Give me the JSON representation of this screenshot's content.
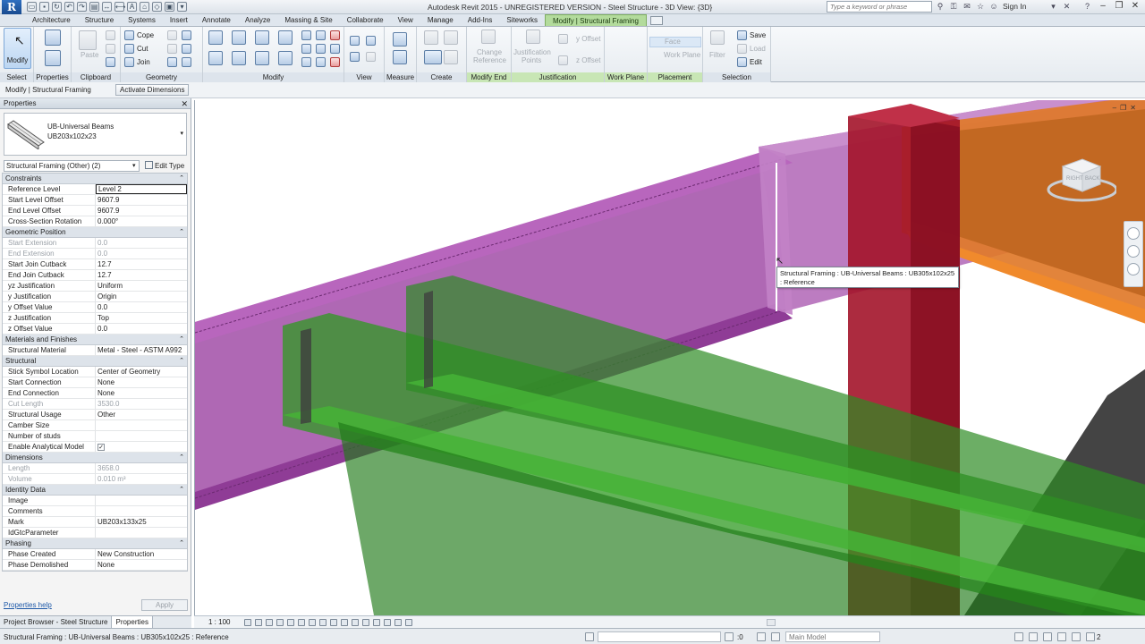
{
  "titlebar": {
    "app_button": "R",
    "window_title": "Autodesk Revit 2015 - UNREGISTERED VERSION -    Steel Structure - 3D View: {3D}",
    "search_placeholder": "Type a keyword or phrase",
    "sign_in": "Sign In"
  },
  "tabs": [
    "Architecture",
    "Structure",
    "Systems",
    "Insert",
    "Annotate",
    "Analyze",
    "Massing & Site",
    "Collaborate",
    "View",
    "Manage",
    "Add-Ins",
    "Siteworks",
    "Modify | Structural Framing"
  ],
  "ribbon": {
    "modify_label": "Modify",
    "panels": {
      "select": "Select",
      "properties": "Properties",
      "clipboard": "Clipboard",
      "geometry": "Geometry",
      "modify": "Modify",
      "view": "View",
      "measure": "Measure",
      "create": "Create",
      "modify_end": "Modify End",
      "justification": "Justification",
      "work_plane": "Work Plane",
      "placement": "Placement",
      "selection": "Selection"
    },
    "paste": "Paste",
    "cope": "Cope",
    "cut": "Cut",
    "join": "Join",
    "change_reference_1": "Change",
    "change_reference_2": "Reference",
    "justification_points_1": "Justification",
    "justification_points_2": "Points",
    "y_offset": "y Offset",
    "z_offset": "z Offset",
    "face": "Face",
    "work_plane_btn": "Work Plane",
    "filter": "Filter",
    "save": "Save",
    "load": "Load",
    "edit": "Edit"
  },
  "optbar": {
    "context": "Modify | Structural Framing",
    "activate_dimensions": "Activate Dimensions"
  },
  "properties": {
    "title": "Properties",
    "type_line1": "UB-Universal Beams",
    "type_line2": "UB203x102x23",
    "filter": "Structural Framing (Other) (2)",
    "edit_type": "Edit Type",
    "groups": [
      {
        "name": "Constraints",
        "rows": [
          {
            "k": "Reference Level",
            "v": "Level 2",
            "sel": true
          },
          {
            "k": "Start Level Offset",
            "v": "9607.9"
          },
          {
            "k": "End Level Offset",
            "v": "9607.9"
          },
          {
            "k": "Cross-Section Rotation",
            "v": "0.000°"
          }
        ]
      },
      {
        "name": "Geometric Position",
        "rows": [
          {
            "k": "Start Extension",
            "v": "0.0",
            "dim": true
          },
          {
            "k": "End Extension",
            "v": "0.0",
            "dim": true
          },
          {
            "k": "Start Join Cutback",
            "v": "12.7"
          },
          {
            "k": "End Join Cutback",
            "v": "12.7"
          },
          {
            "k": "yz Justification",
            "v": "Uniform"
          },
          {
            "k": "y Justification",
            "v": "Origin"
          },
          {
            "k": "y Offset Value",
            "v": "0.0"
          },
          {
            "k": "z Justification",
            "v": "Top"
          },
          {
            "k": "z Offset Value",
            "v": "0.0"
          }
        ]
      },
      {
        "name": "Materials and Finishes",
        "rows": [
          {
            "k": "Structural Material",
            "v": "Metal - Steel - ASTM A992"
          }
        ]
      },
      {
        "name": "Structural",
        "rows": [
          {
            "k": "Stick Symbol Location",
            "v": "Center of Geometry"
          },
          {
            "k": "Start Connection",
            "v": "None"
          },
          {
            "k": "End Connection",
            "v": "None"
          },
          {
            "k": "Cut Length",
            "v": "3530.0",
            "dim": true
          },
          {
            "k": "Structural Usage",
            "v": "Other"
          },
          {
            "k": "Camber Size",
            "v": ""
          },
          {
            "k": "Number of studs",
            "v": ""
          },
          {
            "k": "Enable Analytical Model",
            "v": "✓",
            "check": true
          }
        ]
      },
      {
        "name": "Dimensions",
        "rows": [
          {
            "k": "Length",
            "v": "3658.0",
            "dim": true
          },
          {
            "k": "Volume",
            "v": "0.010 m³",
            "dim": true
          }
        ]
      },
      {
        "name": "Identity Data",
        "rows": [
          {
            "k": "Image",
            "v": ""
          },
          {
            "k": "Comments",
            "v": ""
          },
          {
            "k": "Mark",
            "v": "UB203x133x25"
          },
          {
            "k": "IdGtcParameter",
            "v": ""
          }
        ]
      },
      {
        "name": "Phasing",
        "rows": [
          {
            "k": "Phase Created",
            "v": "New Construction"
          },
          {
            "k": "Phase Demolished",
            "v": "None"
          }
        ]
      }
    ],
    "help": "Properties help",
    "apply": "Apply"
  },
  "browser_tabs": [
    "Project Browser - Steel Structure",
    "Properties"
  ],
  "view": {
    "tooltip_line1": "Structural Framing : UB-Universal Beams : UB305x102x25",
    "tooltip_line2": ": Reference",
    "viewcube_right": "RIGHT",
    "viewcube_back": "BACK",
    "colors": {
      "purple": "#a24fa8",
      "green": "#2f9a22",
      "red": "#a3142a",
      "orange": "#dd6a1f",
      "dark": "#2b2b2b"
    }
  },
  "vcbar": {
    "scale": "1 : 100"
  },
  "status": {
    "text": "Structural Framing : UB-Universal Beams : UB305x102x25 : Reference",
    "zero": ":0",
    "model": "Main Model",
    "filter_count": "2"
  }
}
